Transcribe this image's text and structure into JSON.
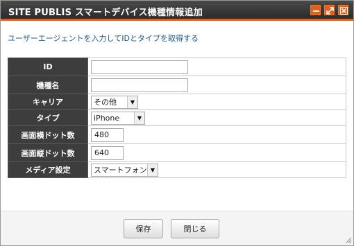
{
  "window": {
    "title": "SITE PUBLIS スマートデバイス機種情報追加"
  },
  "description": "ユーザーエージェントを入力してIDとタイプを取得する",
  "form": {
    "id": {
      "label": "ID",
      "value": ""
    },
    "model_name": {
      "label": "機種名",
      "value": ""
    },
    "carrier": {
      "label": "キャリア",
      "selected": "その他"
    },
    "type": {
      "label": "タイプ",
      "selected": "iPhone"
    },
    "screen_width": {
      "label": "画面横ドット数",
      "value": "480"
    },
    "screen_height": {
      "label": "画面縦ドット数",
      "value": "640"
    },
    "media": {
      "label": "メディア設定",
      "selected": "スマートフォン"
    }
  },
  "buttons": {
    "save": "保存",
    "close": "閉じる"
  },
  "colors": {
    "titlebar": "#333333",
    "accent": "#e35d12",
    "label_bg": "#3d3d3d",
    "description_text": "#1a5a8a"
  },
  "icons": {
    "minimize": "minimize-icon",
    "maximize": "maximize-icon",
    "close": "close-icon",
    "dropdown": "triangle-down"
  }
}
